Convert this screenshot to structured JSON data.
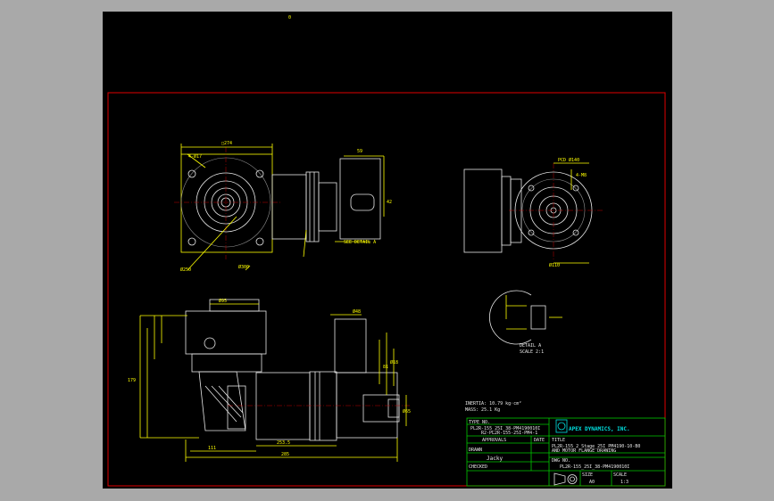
{
  "top_marker": "0",
  "notes": {
    "inertia": "INERTIA: 10.79 kg·cm²",
    "mass": "MASS: 25.1 Kg"
  },
  "detail": {
    "label": "DETAIL A",
    "scale": "SCALE 2:1"
  },
  "views": {
    "sec_detail_a": "SEE DETAIL A",
    "dims_front": [
      "□274",
      "4-Ø17",
      "Ø250",
      "Ø300"
    ],
    "dims_top": [
      "59",
      "42"
    ],
    "dims_right": [
      "PCD Ø140",
      "4-M8",
      "Ø110"
    ],
    "dims_bottom": [
      "Ø95",
      "Ø48",
      "81",
      "253.5",
      "285",
      "111",
      "179",
      "Ø65",
      "Ø18"
    ]
  },
  "title_block": {
    "type_no_label": "TYPE NO.",
    "type_no": "PL2R-155_25I_38-PM4190010I",
    "type_no_sub": "R2-PL2R-155-25I-PM4-1",
    "company": "APEX DYNAMICS, INC.",
    "approvals": "APPROVALS",
    "date": "DATE",
    "title_label": "TITLE",
    "title_line1": "PL2R-155_2 Stage_25I_PM4190-10-B0",
    "title_line2": "AND MOTOR FLANGE DRAWING",
    "drawn_label": "DRAWN",
    "drawn_by": "Jacky",
    "checked_label": "CHECKED",
    "dwg_no_label": "DWG NO.",
    "dwg_no": "PL2R-155_25I_38-PM4190010I",
    "size_label": "SIZE",
    "size": "A0",
    "scale_label": "SCALE",
    "scale": "1:3"
  },
  "colors": {
    "viewport": "#000000",
    "border": "#e00000",
    "geometry": "#ffff00",
    "parts": "#e8e8e8",
    "title_block": "#00c800",
    "logo": "#00e0e0",
    "background": "#a9a9a9"
  }
}
